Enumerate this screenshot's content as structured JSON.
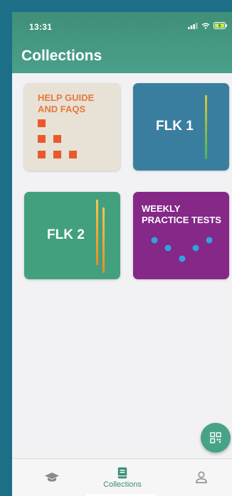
{
  "status_bar": {
    "time": "13:31"
  },
  "header": {
    "title": "Collections"
  },
  "cards": [
    {
      "label": "HELP GUIDE AND FAQS",
      "line1": "HELP GUIDE",
      "line2": "AND FAQS",
      "color": "#e8e1d6",
      "text_color": "#e57a3a"
    },
    {
      "label": "FLK 1",
      "color": "#3a7e9f"
    },
    {
      "label": "FLK 2",
      "color": "#43a07e"
    },
    {
      "label": "WEEKLY PRACTICE TESTS",
      "line1": "WEEKLY",
      "line2": "PRACTICE TESTS",
      "color": "#852888"
    }
  ],
  "fab": {
    "icon": "qr-code-icon"
  },
  "bottom_nav": {
    "items": [
      {
        "icon": "graduation-cap-icon",
        "label": ""
      },
      {
        "icon": "book-icon",
        "label": "Collections",
        "active": true
      },
      {
        "icon": "user-icon",
        "label": ""
      }
    ]
  },
  "colors": {
    "brand": "#48a287",
    "accent_orange": "#e85a2c",
    "dot_blue": "#2fa3e0"
  }
}
